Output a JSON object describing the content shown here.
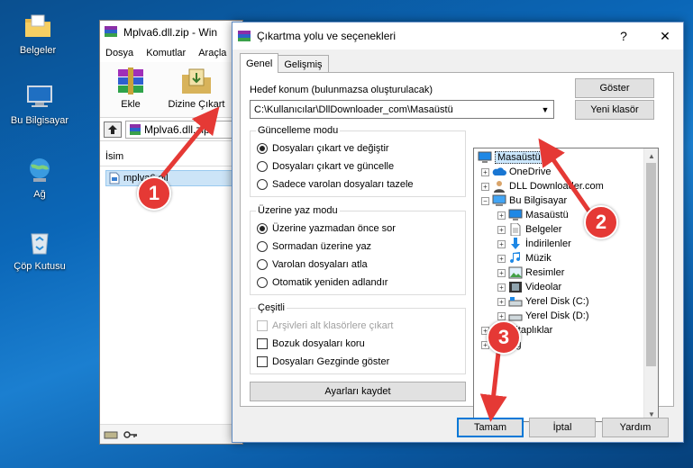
{
  "desktop": {
    "icons": [
      {
        "label": "Belgeler",
        "icon": "folder-icon"
      },
      {
        "label": "Bu Bilgisayar",
        "icon": "computer-icon"
      },
      {
        "label": "Ağ",
        "icon": "network-icon"
      },
      {
        "label": "Çöp Kutusu",
        "icon": "recycle-bin-icon"
      }
    ]
  },
  "winrar": {
    "title": "Mplva6.dll.zip - Win",
    "menu": [
      "Dosya",
      "Komutlar",
      "Araçla"
    ],
    "toolbar": {
      "add_label": "Ekle",
      "extract_label": "Dizine Çıkart"
    },
    "path": "Mplva6.dll.zip",
    "column_name": "İsim",
    "file_name": "mplva6.dll"
  },
  "dialog": {
    "title": "Çıkartma yolu ve seçenekleri",
    "help": "?",
    "close": "✕",
    "tabs": [
      "Genel",
      "Gelişmiş"
    ],
    "dest_label": "Hedef konum (bulunmazsa oluşturulacak)",
    "dest_value": "C:\\Kullanıcılar\\DllDownloader_com\\Masaüstü",
    "show_button": "Göster",
    "new_folder_button": "Yeni klasör",
    "update_mode": {
      "title": "Güncelleme modu",
      "options": [
        "Dosyaları çıkart ve değiştir",
        "Dosyaları çıkart ve güncelle",
        "Sadece varolan dosyaları tazele"
      ],
      "selected": 0
    },
    "overwrite_mode": {
      "title": "Üzerine yaz modu",
      "options": [
        "Üzerine yazmadan önce sor",
        "Sormadan üzerine yaz",
        "Varolan dosyaları atla",
        "Otomatik yeniden adlandır"
      ],
      "selected": 0
    },
    "misc": {
      "title": "Çeşitli",
      "options": [
        "Arşivleri alt klasörlere çıkart",
        "Bozuk dosyaları koru",
        "Dosyaları Gezginde göster"
      ]
    },
    "save_settings_button": "Ayarları kaydet",
    "tree": [
      {
        "label": "Masaüstü",
        "icon": "desktop-icon"
      },
      {
        "label": "OneDrive",
        "icon": "cloud-icon"
      },
      {
        "label": "DLL Downloader.com",
        "icon": "user-icon"
      },
      {
        "label": "Bu Bilgisayar",
        "icon": "computer-icon"
      },
      {
        "label": "Masaüstü",
        "icon": "desktop-icon"
      },
      {
        "label": "Belgeler",
        "icon": "document-icon"
      },
      {
        "label": "İndirilenler",
        "icon": "download-icon"
      },
      {
        "label": "Müzik",
        "icon": "music-icon"
      },
      {
        "label": "Resimler",
        "icon": "picture-icon"
      },
      {
        "label": "Videolar",
        "icon": "video-icon"
      },
      {
        "label": "Yerel Disk (C:)",
        "icon": "drive-icon"
      },
      {
        "label": "Yerel Disk (D:)",
        "icon": "drive-icon"
      },
      {
        "label": "Kitaplıklar",
        "icon": "library-icon"
      },
      {
        "label": "Ağ",
        "icon": "network-icon"
      }
    ],
    "ok_button": "Tamam",
    "cancel_button": "İptal",
    "help_button": "Yardım"
  },
  "annotations": [
    "1",
    "2",
    "3"
  ],
  "colors": {
    "annotation": "#e53935",
    "selection": "#cce8ff",
    "accent": "#0078d7"
  }
}
